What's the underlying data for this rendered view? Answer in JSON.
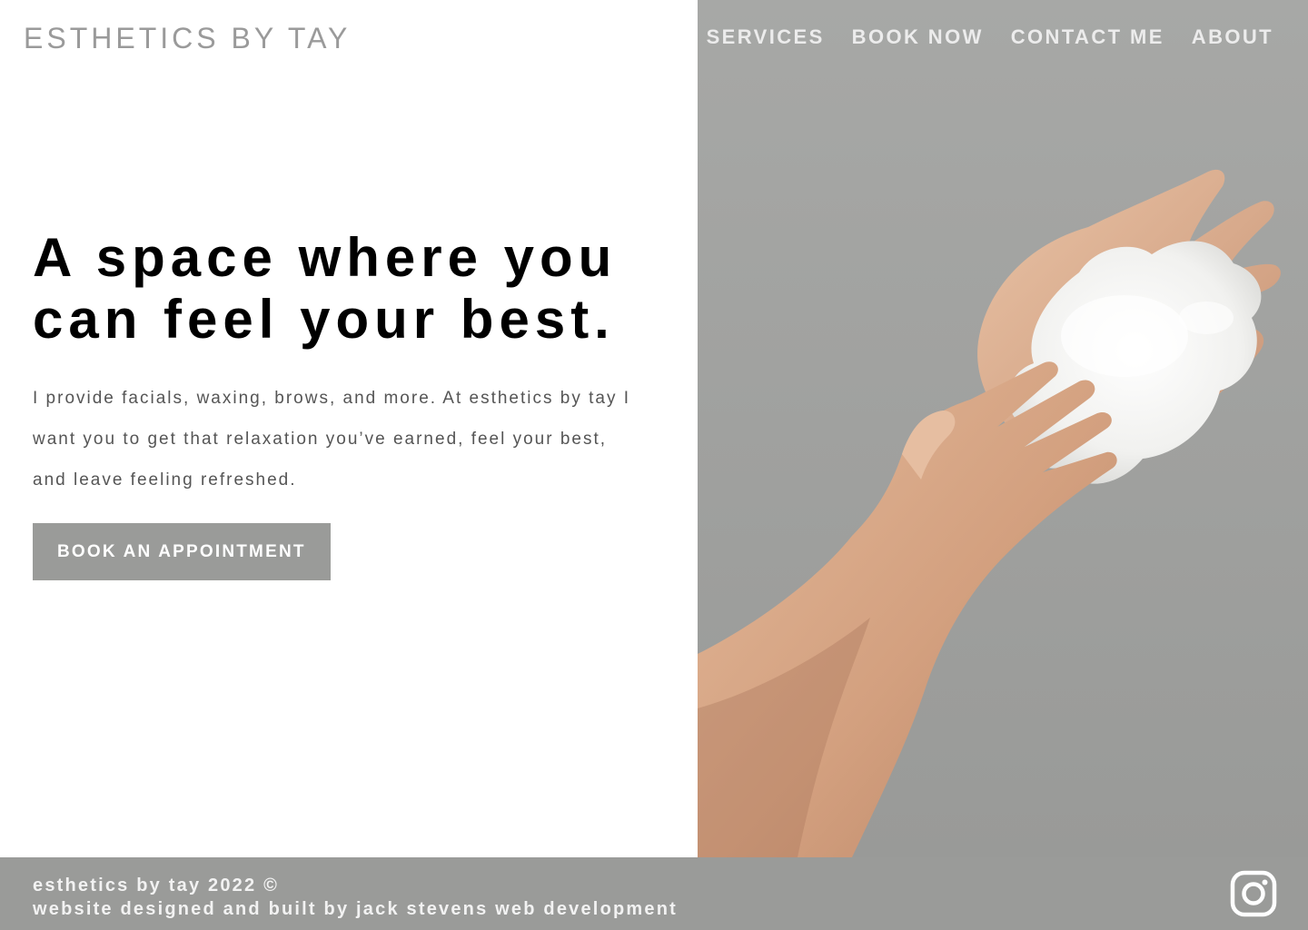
{
  "header": {
    "brand": "ESTHETICS BY TAY",
    "nav": [
      "SERVICES",
      "BOOK NOW",
      "CONTACT ME",
      "ABOUT"
    ]
  },
  "hero": {
    "headline": "A space where you can feel your best.",
    "intro": "I provide facials, waxing, brows, and more. At esthetics by tay I want you to get that relaxation you’ve earned, feel your best, and leave feeling refreshed.",
    "cta": "BOOK AN APPOINTMENT"
  },
  "footer": {
    "copyright": "esthetics by tay 2022 ©",
    "credit": "website designed and built by jack stevens web development",
    "social_icon": "instagram-icon"
  },
  "colors": {
    "accent_grey": "#9a9b99",
    "brand_text": "#9a9a9a",
    "headline": "#000000",
    "body_text": "#555555"
  }
}
